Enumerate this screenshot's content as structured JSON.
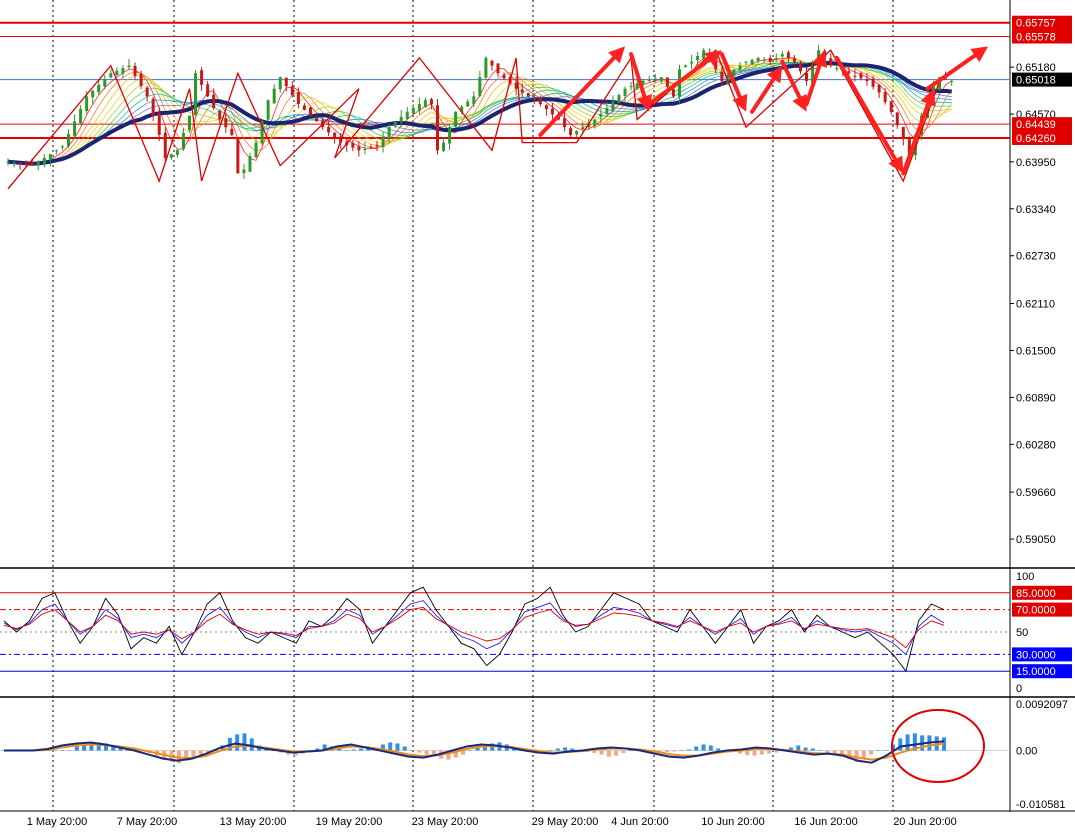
{
  "chart_data": [
    {
      "type": "candlestick",
      "panel": "price",
      "ylim": [
        0.587,
        0.66
      ],
      "y_ticks": [
        "0.65757",
        "0.65578",
        "0.65180",
        "0.65018",
        "0.64570",
        "0.64439",
        "0.64260",
        "0.63950",
        "0.63340",
        "0.62730",
        "0.62110",
        "0.61500",
        "0.60890",
        "0.60280",
        "0.59660",
        "0.59050"
      ],
      "current_price": "0.65018",
      "horizontal_levels": [
        {
          "label": "0.65757",
          "value": 0.65757,
          "color": "#e00000",
          "boxed": true
        },
        {
          "label": "0.65578",
          "value": 0.65578,
          "color": "#e00000",
          "boxed": true
        },
        {
          "label": "0.64439",
          "value": 0.64439,
          "color": "#e00000",
          "boxed": true
        },
        {
          "label": "0.64260",
          "value": 0.6426,
          "color": "#e00000",
          "boxed": true
        }
      ],
      "x_labels": [
        "1 May 20:00",
        "7 May 20:00",
        "13 May 20:00",
        "19 May 20:00",
        "23 May 20:00",
        "29 May 20:00",
        "4 Jun 20:00",
        "10 Jun 20:00",
        "16 Jun 20:00",
        "20 Jun 20:00"
      ],
      "price_path": [
        [
          0,
          0.6395
        ],
        [
          4,
          0.639
        ],
        [
          9,
          0.6415
        ],
        [
          13,
          0.648
        ],
        [
          17,
          0.651
        ],
        [
          20,
          0.652
        ],
        [
          23,
          0.648
        ],
        [
          25,
          0.643
        ],
        [
          26,
          0.64
        ],
        [
          28,
          0.641
        ],
        [
          30,
          0.6455
        ],
        [
          31,
          0.651
        ],
        [
          33,
          0.648
        ],
        [
          35,
          0.645
        ],
        [
          37,
          0.643
        ],
        [
          38,
          0.638
        ],
        [
          39,
          0.6385
        ],
        [
          41,
          0.642
        ],
        [
          43,
          0.6475
        ],
        [
          45,
          0.6505
        ],
        [
          48,
          0.647
        ],
        [
          52,
          0.644
        ],
        [
          55,
          0.642
        ],
        [
          58,
          0.641
        ],
        [
          61,
          0.6415
        ],
        [
          63,
          0.644
        ],
        [
          66,
          0.646
        ],
        [
          69,
          0.6475
        ],
        [
          70,
          0.647
        ],
        [
          71,
          0.641
        ],
        [
          72,
          0.642
        ],
        [
          74,
          0.646
        ],
        [
          77,
          0.648
        ],
        [
          79,
          0.653
        ],
        [
          81,
          0.651
        ],
        [
          84,
          0.649
        ],
        [
          88,
          0.647
        ],
        [
          91,
          0.645
        ],
        [
          93,
          0.643
        ],
        [
          95,
          0.644
        ],
        [
          97,
          0.645
        ],
        [
          99,
          0.6465
        ],
        [
          102,
          0.649
        ],
        [
          105,
          0.65
        ],
        [
          108,
          0.6505
        ],
        [
          110,
          0.648
        ],
        [
          111,
          0.6515
        ],
        [
          113,
          0.6525
        ],
        [
          115,
          0.654
        ],
        [
          117,
          0.6515
        ],
        [
          118,
          0.65
        ],
        [
          120,
          0.6515
        ],
        [
          122,
          0.6525
        ],
        [
          124,
          0.653
        ],
        [
          126,
          0.6525
        ],
        [
          128,
          0.6535
        ],
        [
          130,
          0.6525
        ],
        [
          132,
          0.65
        ],
        [
          133,
          0.652
        ],
        [
          134,
          0.654
        ],
        [
          136,
          0.652
        ],
        [
          139,
          0.651
        ],
        [
          142,
          0.65
        ],
        [
          144,
          0.6485
        ],
        [
          146,
          0.646
        ],
        [
          148,
          0.6425
        ],
        [
          149,
          0.64
        ],
        [
          150,
          0.643
        ],
        [
          152,
          0.648
        ],
        [
          154,
          0.6505
        ],
        [
          156,
          0.65
        ]
      ],
      "zigzag": [
        [
          0,
          0.636
        ],
        [
          17,
          0.652
        ],
        [
          25,
          0.637
        ],
        [
          30,
          0.649
        ],
        [
          32,
          0.637
        ],
        [
          38,
          0.651
        ],
        [
          45,
          0.639
        ],
        [
          58,
          0.649
        ],
        [
          54,
          0.64
        ],
        [
          68,
          0.653
        ],
        [
          80,
          0.641
        ],
        [
          84,
          0.653
        ],
        [
          85,
          0.642
        ],
        [
          94,
          0.642
        ],
        [
          103,
          0.653
        ],
        [
          104,
          0.645
        ],
        [
          117,
          0.654
        ],
        [
          122,
          0.644
        ],
        [
          136,
          0.654
        ],
        [
          148,
          0.637
        ],
        [
          154,
          0.65
        ]
      ],
      "arrows": [
        [
          88,
          0.643,
          102,
          0.6545
        ],
        [
          103,
          0.6535,
          106,
          0.646
        ],
        [
          106,
          0.647,
          118,
          0.654
        ],
        [
          118,
          0.6535,
          122,
          0.646
        ],
        [
          123,
          0.646,
          128,
          0.652
        ],
        [
          128,
          0.6525,
          132,
          0.646
        ],
        [
          132,
          0.647,
          135,
          0.654
        ],
        [
          137,
          0.653,
          148,
          0.638
        ],
        [
          148,
          0.638,
          153,
          0.649
        ],
        [
          152,
          0.649,
          162,
          0.6545
        ]
      ]
    },
    {
      "type": "line",
      "panel": "oscillator",
      "ylim": [
        0,
        100
      ],
      "y_ticks": [
        "100",
        "50",
        "0"
      ],
      "levels": [
        {
          "label": "85.0000",
          "value": 85,
          "color": "#e00000",
          "style": "solid"
        },
        {
          "label": "70.0000",
          "value": 70,
          "color": "#e00000",
          "style": "dashdot"
        },
        {
          "label": "30.0000",
          "value": 30,
          "color": "#0000ff",
          "style": "dashdot"
        },
        {
          "label": "15.0000",
          "value": 15,
          "color": "#0000ff",
          "style": "solid"
        }
      ],
      "series": [
        {
          "color": "#000000",
          "values": [
            60,
            50,
            60,
            80,
            85,
            60,
            40,
            55,
            80,
            65,
            35,
            45,
            40,
            55,
            30,
            50,
            75,
            85,
            60,
            45,
            40,
            50,
            45,
            40,
            60,
            55,
            65,
            80,
            70,
            40,
            55,
            70,
            85,
            90,
            70,
            55,
            40,
            35,
            20,
            30,
            50,
            75,
            80,
            90,
            65,
            50,
            55,
            70,
            85,
            80,
            75,
            60,
            55,
            50,
            70,
            55,
            40,
            55,
            70,
            40,
            55,
            60,
            70,
            50,
            65,
            55,
            50,
            45,
            50,
            40,
            30,
            15,
            60,
            75,
            70
          ]
        },
        {
          "color": "#2020ff",
          "values": [
            58,
            52,
            58,
            70,
            75,
            60,
            48,
            55,
            70,
            62,
            45,
            48,
            45,
            52,
            40,
            50,
            65,
            72,
            58,
            50,
            45,
            50,
            48,
            45,
            55,
            55,
            60,
            70,
            65,
            48,
            55,
            65,
            75,
            78,
            65,
            55,
            46,
            42,
            35,
            40,
            52,
            68,
            72,
            76,
            62,
            55,
            57,
            65,
            72,
            70,
            67,
            60,
            57,
            54,
            63,
            55,
            48,
            55,
            62,
            48,
            55,
            58,
            63,
            52,
            60,
            55,
            52,
            50,
            52,
            46,
            40,
            30,
            55,
            65,
            58
          ]
        },
        {
          "color": "#e00000",
          "values": [
            56,
            53,
            57,
            66,
            70,
            60,
            50,
            55,
            65,
            60,
            48,
            50,
            48,
            52,
            44,
            50,
            60,
            66,
            57,
            52,
            48,
            50,
            49,
            47,
            53,
            55,
            58,
            66,
            62,
            50,
            55,
            62,
            70,
            72,
            62,
            56,
            50,
            46,
            42,
            44,
            52,
            63,
            67,
            70,
            60,
            56,
            57,
            62,
            67,
            66,
            64,
            60,
            58,
            55,
            60,
            55,
            50,
            55,
            58,
            50,
            55,
            57,
            60,
            53,
            57,
            55,
            53,
            52,
            53,
            49,
            45,
            36,
            52,
            60,
            56
          ]
        }
      ]
    },
    {
      "type": "histogram",
      "panel": "macd",
      "ylim": [
        -0.010581,
        0.0092097
      ],
      "y_ticks": [
        "0.0092097",
        "0.00",
        "-0.010581"
      ],
      "histogram_pos_color": "#2f8fe6",
      "histogram_neg_color": "#f4a582",
      "hist_values": [
        0,
        0,
        0,
        0,
        0,
        0,
        0,
        0,
        0,
        0,
        0.0008,
        0.0012,
        0.0015,
        0.0016,
        0.0014,
        0.001,
        0.0007,
        0.0004,
        0.0002,
        0,
        -0.0005,
        -0.001,
        -0.0018,
        -0.0022,
        -0.0025,
        -0.002,
        -0.0015,
        -0.0008,
        -0.0004,
        0,
        0.001,
        0.0025,
        0.0032,
        0.0034,
        0.0024,
        0.001,
        0.0005,
        0,
        -0.0004,
        -0.0008,
        -0.001,
        -0.0006,
        0,
        0.0004,
        0.0012,
        0.0008,
        0.0003,
        0,
        0.0002,
        0.0004,
        0.0006,
        0.0006,
        0.0012,
        0.0016,
        0.0014,
        0.0008,
        0,
        -0.0004,
        -0.0008,
        -0.0012,
        -0.0016,
        -0.0018,
        -0.0014,
        -0.0008,
        0,
        0.0006,
        0.001,
        0.0014,
        0.0016,
        0.0012,
        0.0006,
        0,
        -0.0003,
        -0.0006,
        -0.0004,
        0,
        0.0004,
        0.0006,
        0.0004,
        0,
        -0.0003,
        -0.0005,
        -0.0008,
        -0.0012,
        -0.001,
        -0.0005,
        0,
        0.0002,
        0.0002,
        0,
        -0.0002,
        -0.0003,
        -0.0002,
        0,
        0.0002,
        0.0008,
        0.0012,
        0.001,
        0.0004,
        0,
        -0.0003,
        -0.0006,
        -0.0009,
        -0.001,
        -0.0008,
        -0.0006,
        -0.0004,
        0,
        0.0006,
        0.001,
        0.0006,
        0.0004,
        0,
        -0.0004,
        -0.0008,
        -0.0012,
        -0.0016,
        -0.0018,
        -0.0014,
        -0.0008,
        0,
        0,
        0.0012,
        0.0024,
        0.0032,
        0.0034,
        0.003,
        0.003,
        0.0028,
        0.0026
      ],
      "macd_color": "#1a2a7a",
      "signal_color": "#f08c1a",
      "macd_values": [
        0,
        0,
        0,
        0.0003,
        0.001,
        0.0014,
        0.0016,
        0.0012,
        0.0006,
        0,
        -0.0008,
        -0.0016,
        -0.002,
        -0.0016,
        -0.0006,
        0.0006,
        0.0014,
        0.001,
        0.0004,
        0,
        -0.0004,
        -0.0002,
        0,
        0.0008,
        0.0012,
        0.0006,
        0,
        -0.0006,
        -0.0012,
        -0.0014,
        -0.0008,
        0,
        0.0008,
        0.0012,
        0.001,
        0.0006,
        0,
        -0.0004,
        -0.0006,
        -0.0002,
        0,
        0.0004,
        0.0006,
        0.0004,
        0,
        -0.0006,
        -0.0012,
        -0.0014,
        -0.001,
        -0.0004,
        0,
        0.0002,
        0.0006,
        0.0004,
        0,
        -0.0004,
        -0.0008,
        -0.0006,
        -0.001,
        -0.002,
        -0.0024,
        -0.001,
        0.0008,
        0.0012,
        0.0016,
        0.0018
      ],
      "signal_values": [
        0,
        0,
        0,
        0.0001,
        0.0006,
        0.001,
        0.0012,
        0.0011,
        0.0008,
        0.0004,
        -0.0002,
        -0.0008,
        -0.0014,
        -0.0015,
        -0.001,
        0,
        0.0008,
        0.0009,
        0.0006,
        0.0002,
        -0.0002,
        -0.0002,
        0,
        0.0004,
        0.0008,
        0.0007,
        0.0003,
        -0.0002,
        -0.0008,
        -0.0011,
        -0.0009,
        -0.0004,
        0.0003,
        0.0008,
        0.0009,
        0.0007,
        0.0003,
        -0.0001,
        -0.0004,
        -0.0003,
        -0.0001,
        0.0002,
        0.0004,
        0.0004,
        0.0002,
        -0.0002,
        -0.0007,
        -0.001,
        -0.001,
        -0.0006,
        -0.0002,
        0,
        0.0003,
        0.0003,
        0.0001,
        -0.0002,
        -0.0005,
        -0.0006,
        -0.0008,
        -0.0014,
        -0.0018,
        -0.0014,
        -0.0004,
        0.0004,
        0.001,
        0.0014
      ],
      "highlight_circle_color": "#e00000"
    }
  ]
}
